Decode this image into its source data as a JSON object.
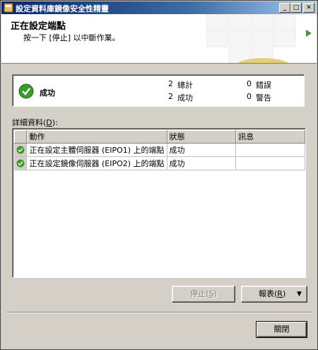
{
  "window": {
    "title": "設定資料庫鏡像安全性精靈"
  },
  "header": {
    "title": "正在設定端點",
    "subtitle": "按一下 [停止] 以中斷作業。"
  },
  "summary": {
    "status": "成功",
    "total": {
      "count": "2",
      "label": "總計"
    },
    "success": {
      "count": "2",
      "label": "成功"
    },
    "error": {
      "count": "0",
      "label": "錯誤"
    },
    "warning": {
      "count": "0",
      "label": "警告"
    }
  },
  "details": {
    "label_prefix": "詳細資料(",
    "label_key": "D",
    "label_suffix": "):",
    "columns": [
      "動作",
      "狀態",
      "訊息"
    ],
    "rows": [
      {
        "action": "正在設定主體伺服器 (EIPO1) 上的端點",
        "status": "成功",
        "message": ""
      },
      {
        "action": "正在設定鏡像伺服器 (EIPO2) 上的端點",
        "status": "成功",
        "message": ""
      }
    ]
  },
  "buttons": {
    "stop": {
      "label": "停止(",
      "key": "S",
      "suffix": ")"
    },
    "report": {
      "label": "報表(",
      "key": "R",
      "suffix": ")"
    },
    "close": "關閉"
  },
  "colors": {
    "success": "#3a9a2a",
    "title_bar": "#0a246a"
  }
}
